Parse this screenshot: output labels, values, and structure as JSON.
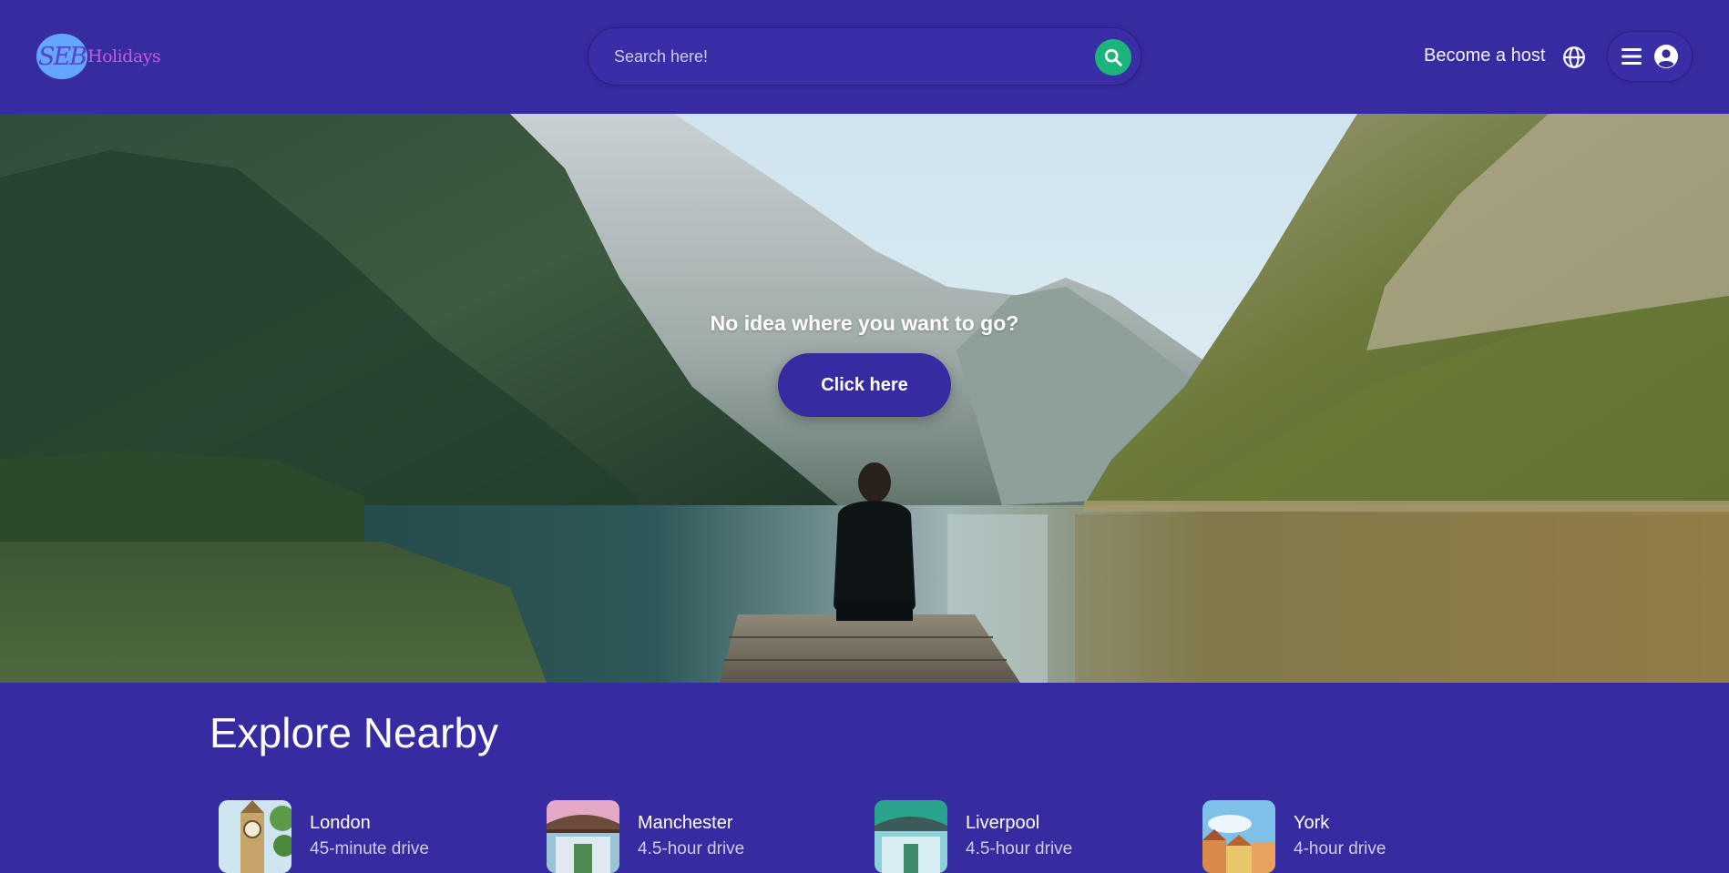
{
  "brand": {
    "badge": "SEB",
    "name": "Holidays"
  },
  "search": {
    "placeholder": "Search here!",
    "icon": "search-icon",
    "button_color": "#1bb57a"
  },
  "nav": {
    "become_host": "Become a host",
    "globe_icon": "globe-icon",
    "menu_icon": "hamburger-icon",
    "profile_icon": "user-circle-icon"
  },
  "hero": {
    "headline": "No idea where you want to go?",
    "cta": "Click here"
  },
  "explore": {
    "title": "Explore Nearby",
    "items": [
      {
        "name": "London",
        "distance": "45-minute drive"
      },
      {
        "name": "Manchester",
        "distance": "4.5-hour drive"
      },
      {
        "name": "Liverpool",
        "distance": "4.5-hour drive"
      },
      {
        "name": "York",
        "distance": "4-hour drive"
      }
    ]
  },
  "colors": {
    "primary": "#372ba1",
    "accent": "#1bb57a",
    "logo_badge": "#63a6ff",
    "logo_text": "#c45bdc"
  }
}
